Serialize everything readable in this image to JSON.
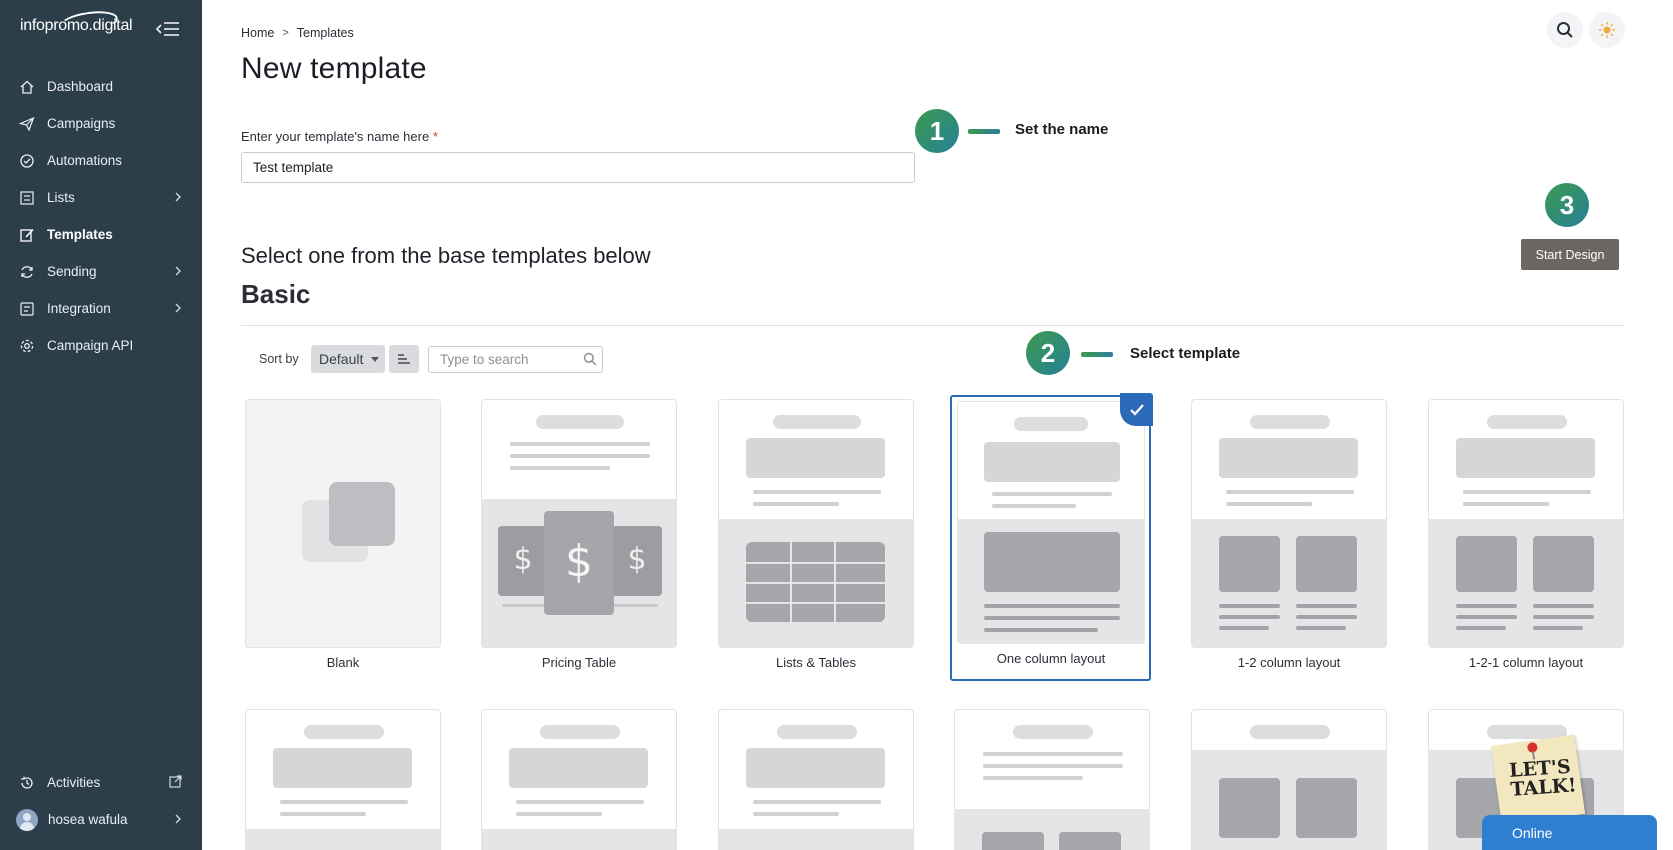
{
  "sidebar": {
    "brand": "infopromo.digital",
    "items": [
      {
        "label": "Dashboard",
        "icon": "home-icon"
      },
      {
        "label": "Campaigns",
        "icon": "send-icon"
      },
      {
        "label": "Automations",
        "icon": "automation-icon"
      },
      {
        "label": "Lists",
        "icon": "list-icon"
      },
      {
        "label": "Templates",
        "icon": "template-edit-icon"
      },
      {
        "label": "Sending",
        "icon": "sync-icon"
      },
      {
        "label": "Integration",
        "icon": "integration-icon"
      },
      {
        "label": "Campaign API",
        "icon": "gear-icon"
      }
    ],
    "bottom": {
      "activities": "Activities",
      "user_name": "hosea wafula"
    }
  },
  "breadcrumb": {
    "home": "Home",
    "sep": ">",
    "current": "Templates"
  },
  "page_title": "New template",
  "form": {
    "name_label": "Enter your template's name here",
    "required_mark": "*",
    "name_value": "Test template"
  },
  "steps": {
    "one": {
      "number": "1",
      "text": "Set the name"
    },
    "two": {
      "number": "2",
      "text": "Select template"
    },
    "three": {
      "number": "3"
    }
  },
  "start_design": "Start Design",
  "section_title": "Select one from the base templates below",
  "group_title": "Basic",
  "toolbar": {
    "sort_label": "Sort by",
    "sort_value": "Default",
    "search_placeholder": "Type to search"
  },
  "templates": [
    {
      "label": "Blank"
    },
    {
      "label": "Pricing Table"
    },
    {
      "label": "Lists & Tables"
    },
    {
      "label": "One column layout",
      "selected": true
    },
    {
      "label": "1-2 column layout"
    },
    {
      "label": "1-2-1 column layout"
    }
  ],
  "pricing_symbols": [
    "$",
    "$",
    "$"
  ],
  "chat": {
    "sticky": "LET'S TALK!",
    "status": "Online"
  },
  "colors": {
    "sidebar_bg": "#2d3e4b",
    "accent_blue": "#2a6ab8",
    "step_green": "#3f9a4f",
    "button_gray": "#6b6564",
    "chat_blue": "#2e7fd0"
  }
}
